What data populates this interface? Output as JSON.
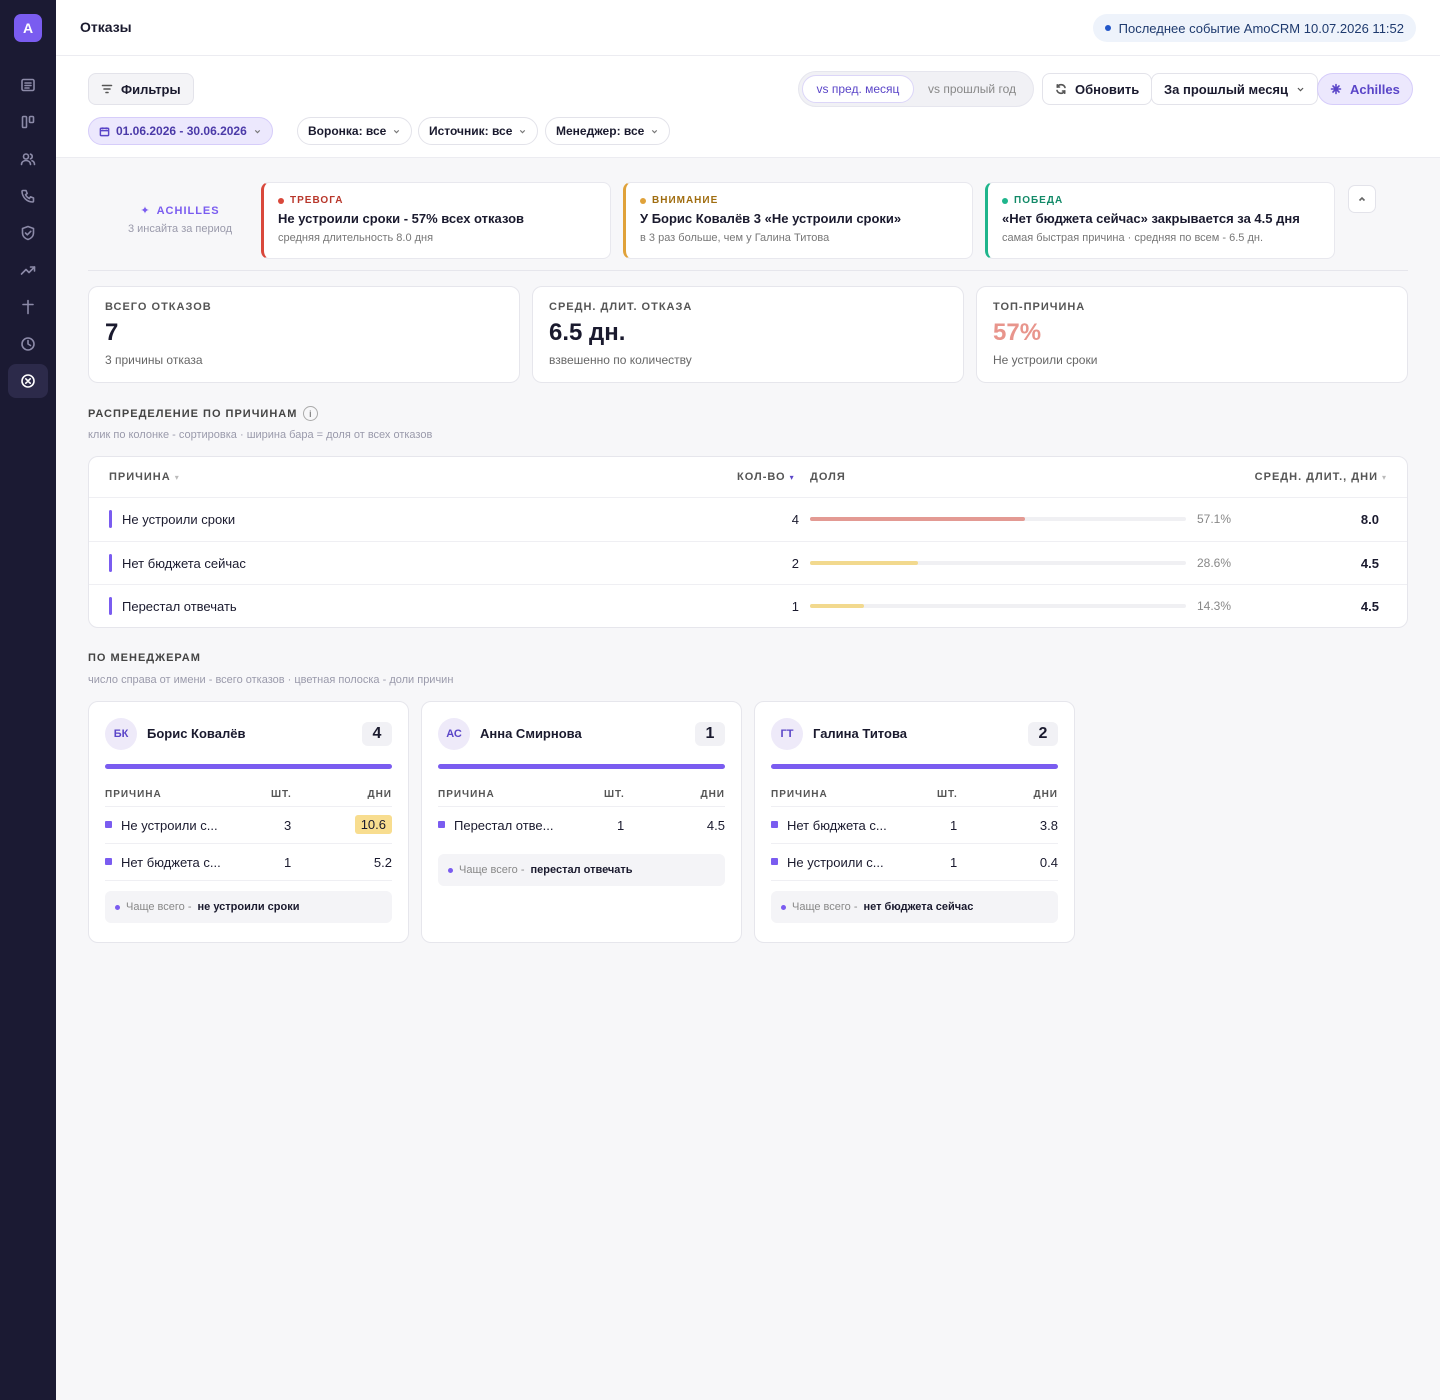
{
  "sidebar": {
    "logo": "A"
  },
  "header": {
    "title": "Отказы",
    "event_status": "Последнее событие AmoCRM 10.07.2026 11:52"
  },
  "toolbar": {
    "filters_label": "Фильтры",
    "compare_options": [
      "vs пред. месяц",
      "vs прошлый год"
    ],
    "compare_selected": "vs пред. месяц",
    "refresh_label": "Обновить",
    "period_label": "За прошлый месяц",
    "achilles_label": "Achilles"
  },
  "chips": {
    "date": "01.06.2026 - 30.06.2026",
    "funnel": "Воронка: все",
    "source": "Источник: все",
    "manager": "Менеджер: все"
  },
  "insights": {
    "title": "ACHILLES",
    "subtitle": "3 инсайта за период",
    "cards": [
      {
        "tag": "ТРЕВОГА",
        "color": "#d9483b",
        "title": "Не устроили сроки - 57% всех отказов",
        "sub": "средняя длительность 8.0 дня"
      },
      {
        "tag": "ВНИМАНИЕ",
        "color": "#e0a23a",
        "title": "У Борис Ковалёв 3 «Не устроили сроки»",
        "sub": "в 3 раз больше, чем у Галина Титова"
      },
      {
        "tag": "ПОБЕДА",
        "color": "#1fb58c",
        "title": "«Нет бюджета сейчас» закрывается за 4.5 дня",
        "sub": "самая быстрая причина · средняя по всем - 6.5 дн."
      }
    ]
  },
  "kpis": [
    {
      "label": "ВСЕГО ОТКАЗОВ",
      "value": "7",
      "sub": "3 причины отказа",
      "color": "#1a1a2e"
    },
    {
      "label": "СРЕДН. ДЛИТ. ОТКАЗА",
      "value": "6.5 дн.",
      "sub": "взвешенно по количеству",
      "color": "#1a1a2e"
    },
    {
      "label": "ТОП-ПРИЧИНА",
      "value": "57%",
      "sub": "Не устроили сроки",
      "color": "#e8958c"
    }
  ],
  "distribution": {
    "title": "РАСПРЕДЕЛЕНИЕ ПО ПРИЧИНАМ",
    "info_icon": "i",
    "subtitle": "клик по колонке - сортировка · ширина бара = доля от всех отказов",
    "columns": {
      "reason": "ПРИЧИНА",
      "count": "КОЛ-ВО",
      "share": "ДОЛЯ",
      "duration": "СРЕДН. ДЛИТ., ДНИ"
    },
    "sort_arrow": "▾",
    "rows": [
      {
        "reason": "Не устроили сроки",
        "count": "4",
        "share_pct": "57.1%",
        "share": 0.571,
        "duration": "8.0",
        "color": "#e39a93"
      },
      {
        "reason": "Нет бюджета сейчас",
        "count": "2",
        "share_pct": "28.6%",
        "share": 0.286,
        "duration": "4.5",
        "color": "#f2d98e"
      },
      {
        "reason": "Перестал отвечать",
        "count": "1",
        "share_pct": "14.3%",
        "share": 0.143,
        "duration": "4.5",
        "color": "#f2d98e"
      }
    ]
  },
  "managers": {
    "title": "ПО МЕНЕДЖЕРАМ",
    "subtitle": "число справа от имени - всего отказов · цветная полоска - доли причин",
    "col_reason": "ПРИЧИНА",
    "col_count": "ШТ.",
    "col_days": "ДНИ",
    "footer_prefix": "Чаще всего -",
    "list": [
      {
        "initials": "БК",
        "name": "Борис Ковалёв",
        "total": "4",
        "top": "не устроили сроки",
        "rows": [
          {
            "reason": "Не устроили с...",
            "count": "3",
            "days": "10.6",
            "highlight": true
          },
          {
            "reason": "Нет бюджета с...",
            "count": "1",
            "days": "5.2",
            "highlight": false
          }
        ]
      },
      {
        "initials": "АС",
        "name": "Анна Смирнова",
        "total": "1",
        "top": "перестал отвечать",
        "rows": [
          {
            "reason": "Перестал отве...",
            "count": "1",
            "days": "4.5",
            "highlight": false
          }
        ]
      },
      {
        "initials": "ГТ",
        "name": "Галина Титова",
        "total": "2",
        "top": "нет бюджета сейчас",
        "rows": [
          {
            "reason": "Нет бюджета с...",
            "count": "1",
            "days": "3.8",
            "highlight": false
          },
          {
            "reason": "Не устроили с...",
            "count": "1",
            "days": "0.4",
            "highlight": false
          }
        ]
      }
    ]
  }
}
